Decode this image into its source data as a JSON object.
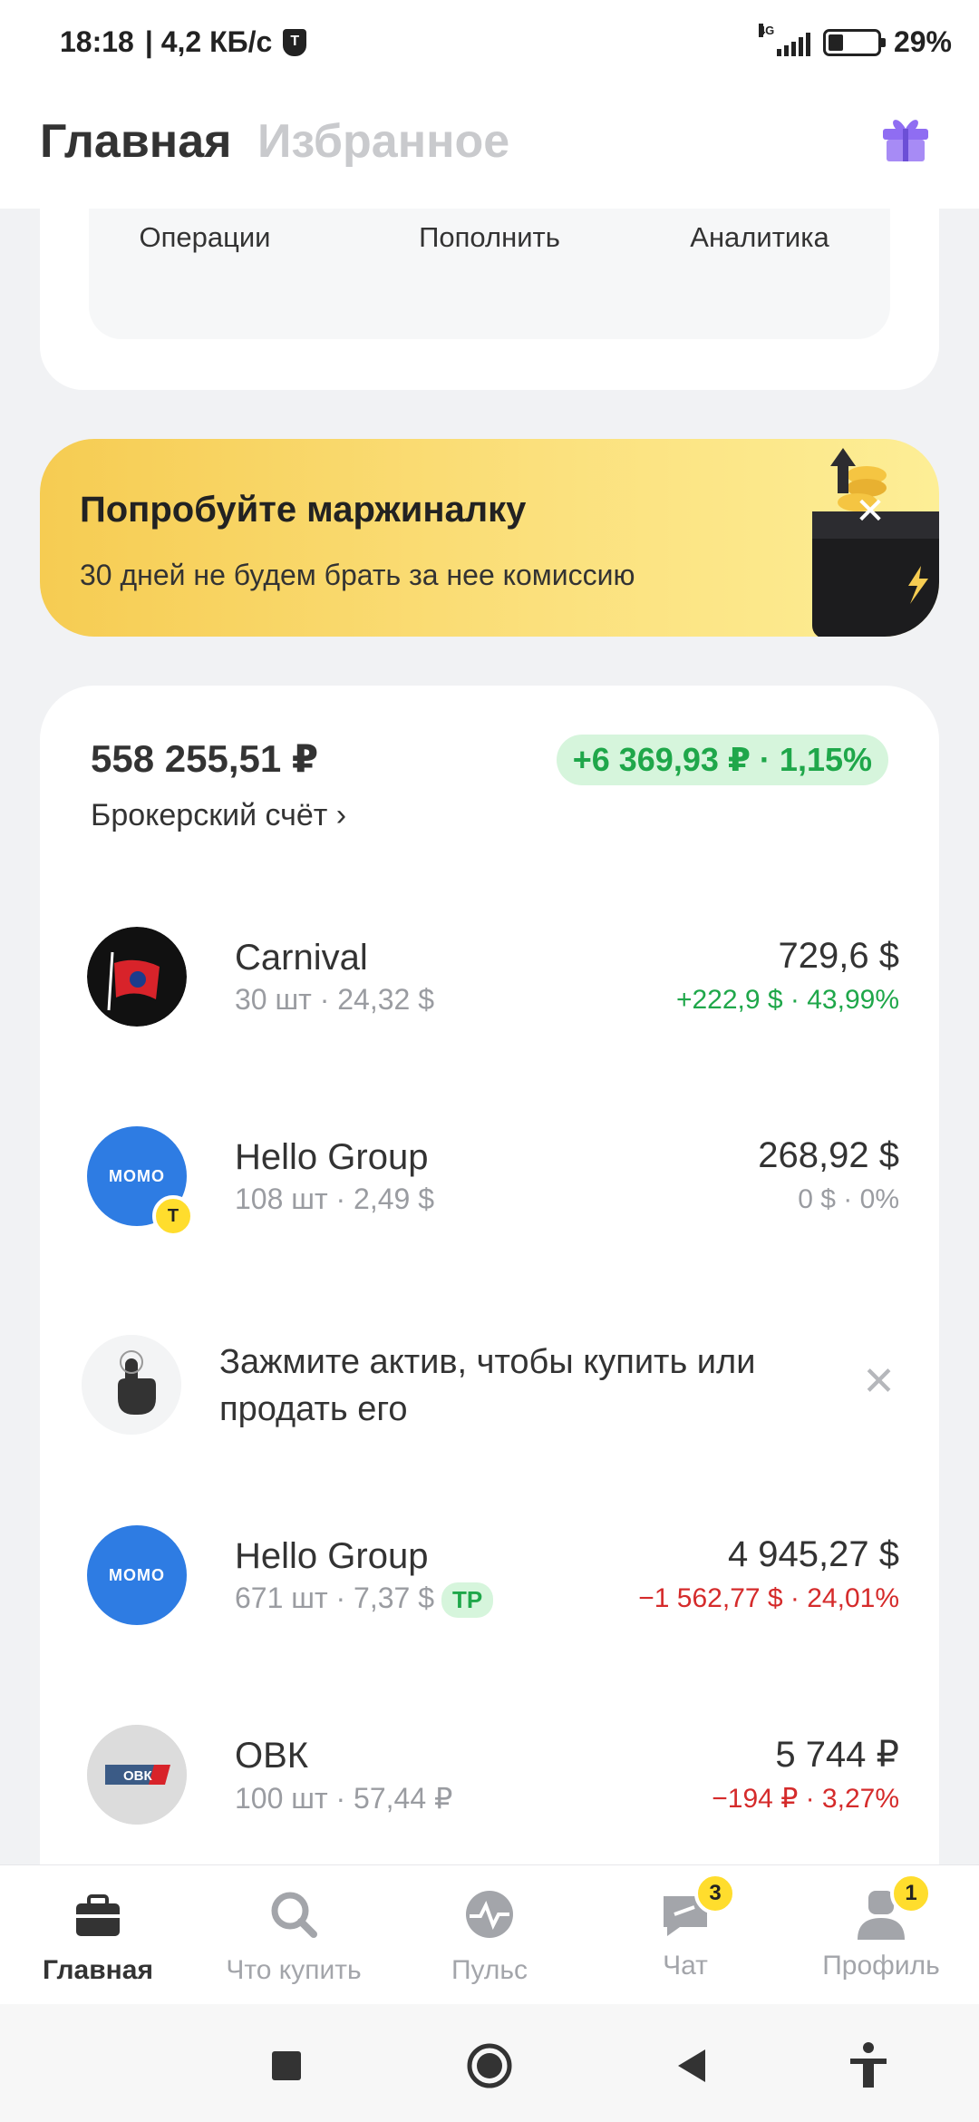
{
  "status_bar": {
    "time": "18:18",
    "speed": "| 4,2 КБ/с",
    "network": "4G",
    "battery": "29%"
  },
  "header": {
    "tab_main": "Главная",
    "tab_favorites": "Избранное"
  },
  "actions": [
    {
      "label": "Операции",
      "icon": "clock-icon"
    },
    {
      "label": "Пополнить",
      "icon": "plus-icon"
    },
    {
      "label": "Аналитика",
      "icon": "pie-icon"
    }
  ],
  "promo": {
    "title": "Попробуйте маржиналку",
    "subtitle": "30 дней не будем брать за нее комиссию"
  },
  "portfolio": {
    "total": "558 255,51 ₽",
    "profit": "+6 369,93 ₽ · 1,15%",
    "account": "Брокерский счёт ›"
  },
  "holdings": [
    {
      "name": "Carnival",
      "qty": "30 шт · 24,32 $",
      "value": "729,6 $",
      "change": "+222,9 $ · 43,99%",
      "trend": "up"
    },
    {
      "name": "Hello Group",
      "qty": "108 шт · 2,49 $",
      "value": "268,92 $",
      "change": "0 $ · 0%",
      "trend": "flat",
      "logo_text": "MOMO",
      "badge": "T"
    },
    {
      "name": "Hello Group",
      "qty": "671 шт · 7,37 $",
      "tag": "TP",
      "value": "4 945,27 $",
      "change": "−1 562,77 $ · 24,01%",
      "trend": "down",
      "logo_text": "MOMO"
    },
    {
      "name": "ОВК",
      "qty": "100 шт · 57,44 ₽",
      "value": "5 744 ₽",
      "change": "−194 ₽ · 3,27%",
      "trend": "down",
      "logo_text": "ОВК"
    }
  ],
  "hint": {
    "text": "Зажмите актив, чтобы купить или продать его"
  },
  "bottom_nav": [
    {
      "label": "Главная",
      "icon": "briefcase-icon",
      "active": true
    },
    {
      "label": "Что купить",
      "icon": "search-icon"
    },
    {
      "label": "Пульс",
      "icon": "pulse-icon"
    },
    {
      "label": "Чат",
      "icon": "chat-icon",
      "badge": "3"
    },
    {
      "label": "Профиль",
      "icon": "profile-icon",
      "badge": "1"
    }
  ],
  "colors": {
    "positive": "#1fa74a",
    "negative": "#d52b2b",
    "accent_yellow": "#ffdd2d",
    "gift": "#8f6df2"
  }
}
